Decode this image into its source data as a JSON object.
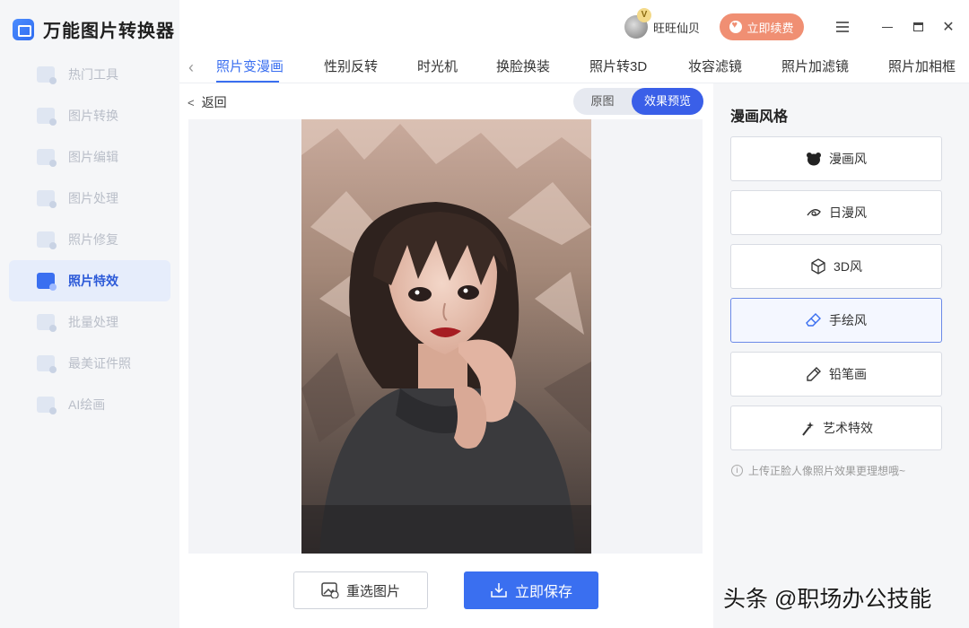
{
  "app": {
    "title": "万能图片转换器"
  },
  "sidebar": {
    "items": [
      {
        "label": "热门工具",
        "active": false
      },
      {
        "label": "图片转换",
        "active": false
      },
      {
        "label": "图片编辑",
        "active": false
      },
      {
        "label": "图片处理",
        "active": false
      },
      {
        "label": "照片修复",
        "active": false
      },
      {
        "label": "照片特效",
        "active": true
      },
      {
        "label": "批量处理",
        "active": false
      },
      {
        "label": "最美证件照",
        "active": false
      },
      {
        "label": "AI绘画",
        "active": false
      }
    ]
  },
  "header": {
    "vip_badge": "V",
    "username": "旺旺仙贝",
    "renew_label": "立即续费"
  },
  "tabs": [
    {
      "label": "照片变漫画",
      "active": true
    },
    {
      "label": "性别反转"
    },
    {
      "label": "时光机"
    },
    {
      "label": "换脸换装"
    },
    {
      "label": "照片转3D"
    },
    {
      "label": "妆容滤镜"
    },
    {
      "label": "照片加滤镜"
    },
    {
      "label": "照片加相框"
    }
  ],
  "workspace": {
    "back_label": "返回",
    "toggle": {
      "original": "原图",
      "preview": "效果预览"
    },
    "reselect_label": "重选图片",
    "save_label": "立即保存"
  },
  "panel": {
    "title": "漫画风格",
    "styles": [
      {
        "label": "漫画风",
        "icon": "bear-icon"
      },
      {
        "label": "日漫风",
        "icon": "swirl-icon"
      },
      {
        "label": "3D风",
        "icon": "cube-icon"
      },
      {
        "label": "手绘风",
        "icon": "eraser-icon",
        "selected": true
      },
      {
        "label": "铅笔画",
        "icon": "pencil-icon"
      },
      {
        "label": "艺术特效",
        "icon": "magic-wand-icon"
      }
    ],
    "hint": "上传正脸人像照片效果更理想哦~"
  },
  "watermark": "头条 @职场办公技能",
  "colors": {
    "accent": "#3a6ff0",
    "renew": "#f08f73",
    "sidebar_bg": "#f5f6f8"
  }
}
